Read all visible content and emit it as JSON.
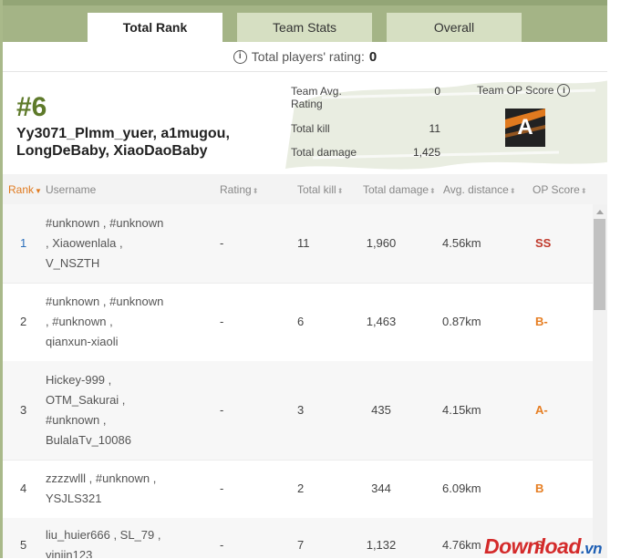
{
  "tabs": [
    {
      "label": "Total Rank",
      "active": true
    },
    {
      "label": "Team Stats",
      "active": false
    },
    {
      "label": "Overall",
      "active": false
    }
  ],
  "players_rating": {
    "label": "Total players' rating:",
    "value": "0"
  },
  "team": {
    "rank": "#6",
    "names": "Yy3071_Plmm_yuer, a1mugou, LongDeBaby, XiaoDaoBaby",
    "stats": [
      {
        "label": "Team Avg. Rating",
        "value": "0"
      },
      {
        "label": "Total kill",
        "value": "11"
      },
      {
        "label": "Total damage",
        "value": "1,425"
      }
    ],
    "op_score_label": "Team OP Score",
    "op_score": "A"
  },
  "table": {
    "headers": {
      "rank": "Rank",
      "username": "Username",
      "rating": "Rating",
      "kill": "Total kill",
      "damage": "Total damage",
      "distance": "Avg. distance",
      "op": "OP Score"
    },
    "rows": [
      {
        "rank": "1",
        "lines": [
          "#unknown , #unknown",
          ", Xiaowenlala ,",
          "V_NSZTH"
        ],
        "rating": "-",
        "kill": "11",
        "damage": "1,960",
        "distance": "4.56km",
        "op": "SS",
        "op_color": "#c0392b"
      },
      {
        "rank": "2",
        "lines": [
          "#unknown , #unknown",
          ", #unknown ,",
          "qianxun-xiaoli"
        ],
        "rating": "-",
        "kill": "6",
        "damage": "1,463",
        "distance": "0.87km",
        "op": "B-",
        "op_color": "#e67e22"
      },
      {
        "rank": "3",
        "lines": [
          "Hickey-999 ,",
          "OTM_Sakurai ,",
          "#unknown ,",
          "BulalaTv_10086"
        ],
        "rating": "-",
        "kill": "3",
        "damage": "435",
        "distance": "4.15km",
        "op": "A-",
        "op_color": "#e67e22"
      },
      {
        "rank": "4",
        "lines": [
          "zzzzwlll , #unknown ,",
          "YSJLS321"
        ],
        "rating": "-",
        "kill": "2",
        "damage": "344",
        "distance": "6.09km",
        "op": "B",
        "op_color": "#e67e22"
      },
      {
        "rank": "5",
        "lines": [
          "liu_huier666 , SL_79 ,",
          "yinjin123"
        ],
        "rating": "-",
        "kill": "7",
        "damage": "1,132",
        "distance": "4.76km",
        "op": "S",
        "op_color": "#c0392b"
      }
    ]
  },
  "watermark": {
    "text": "Download",
    "suffix": ".vn"
  }
}
